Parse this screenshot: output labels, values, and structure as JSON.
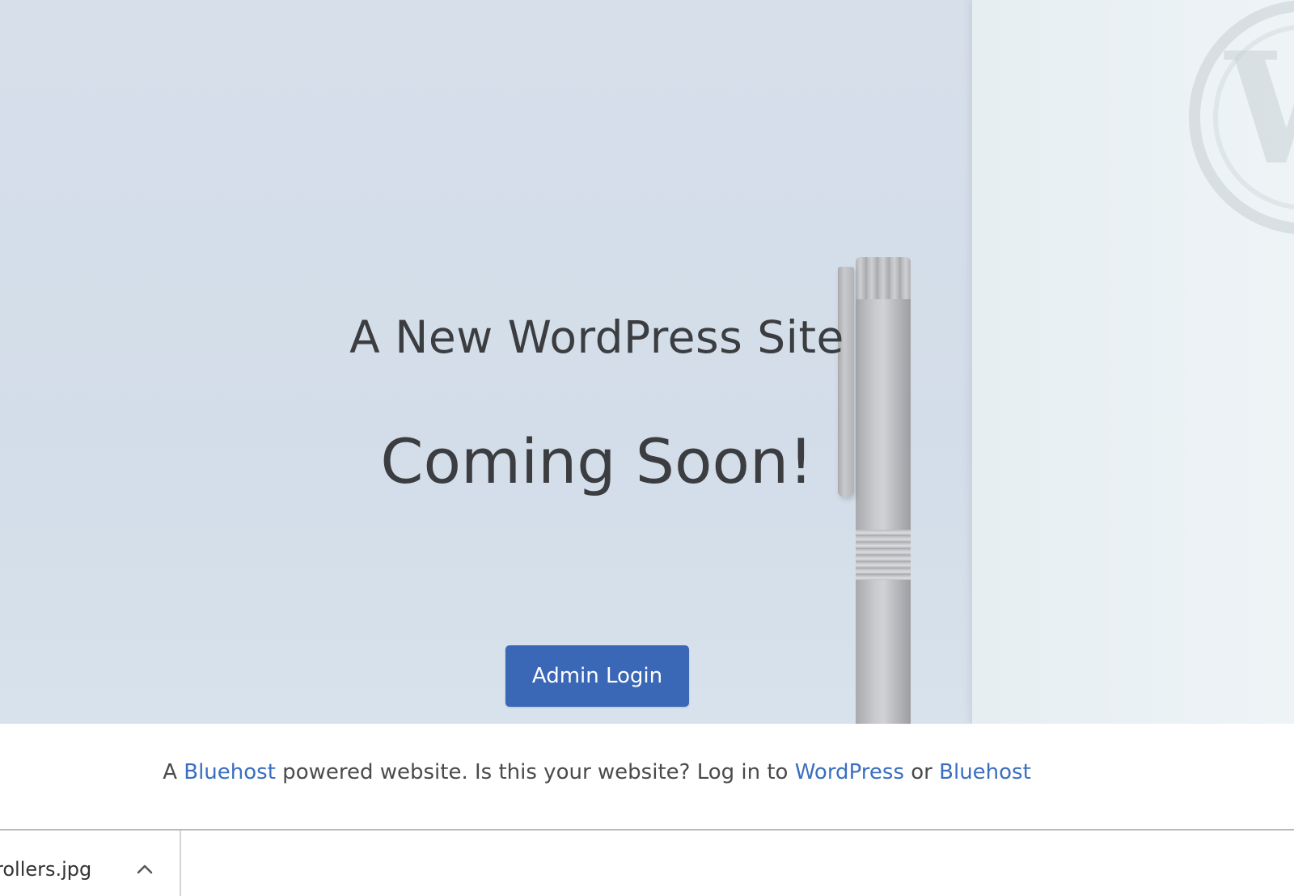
{
  "hero": {
    "title": "A New WordPress Site",
    "subtitle": "Coming Soon!",
    "admin_button_label": "Admin Login",
    "background_color": "#d6dfea",
    "accent_color": "#3b67b7"
  },
  "footer": {
    "prefix": "A ",
    "link1": "Bluehost",
    "middle": " powered website. Is this your website? Log in to ",
    "link2": "WordPress",
    "or": " or ",
    "link3": "Bluehost",
    "link_color": "#3a6fc0"
  },
  "downloads": {
    "items": [
      {
        "filename": "rollers.jpg",
        "icon": "chevron-up-icon"
      }
    ]
  }
}
